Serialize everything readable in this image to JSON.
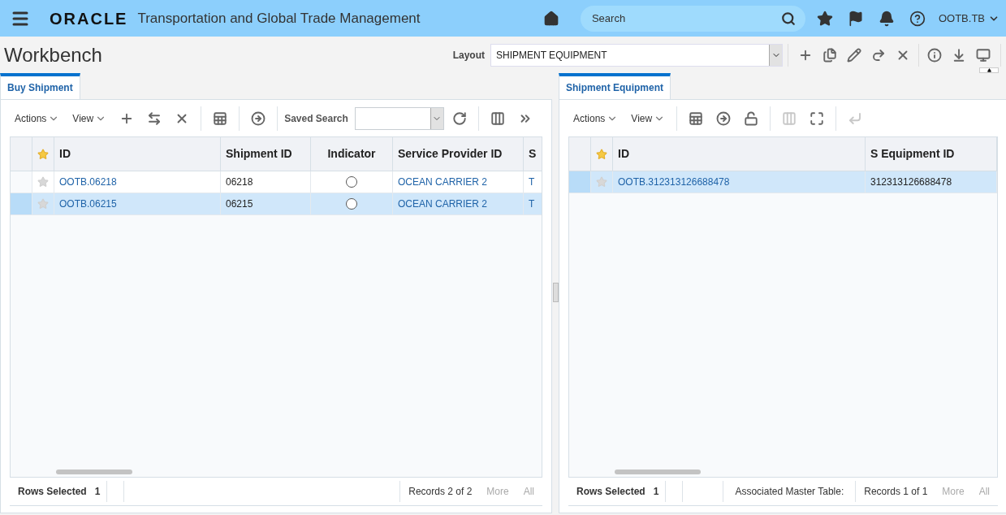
{
  "header": {
    "logo": "ORACLE",
    "app_title": "Transportation and Global Trade Management",
    "search": {
      "placeholder": "Search"
    },
    "user": "OOTB.TB"
  },
  "page_title": "Workbench",
  "layout": {
    "label": "Layout",
    "value": "SHIPMENT EQUIPMENT"
  },
  "layout_tools": [
    {
      "kind": "add",
      "disabled": false
    },
    {
      "kind": "copy",
      "disabled": false
    },
    {
      "kind": "edit",
      "disabled": false
    },
    {
      "kind": "redo",
      "disabled": false
    },
    {
      "kind": "delete",
      "disabled": false
    },
    {
      "kind": "info",
      "disabled": false
    },
    {
      "kind": "download",
      "disabled": false
    },
    {
      "kind": "monitor",
      "disabled": false
    }
  ],
  "panels": [
    {
      "tab": {
        "label": "Buy Shipment",
        "selected": true
      },
      "menus": [
        "Actions",
        "View"
      ],
      "tools": [
        {
          "kind": "add",
          "disabled": false
        },
        {
          "kind": "swap",
          "disabled": false
        },
        {
          "kind": "delete",
          "disabled": false
        },
        {
          "kind": "sep"
        },
        {
          "kind": "table-export",
          "disabled": false
        },
        {
          "kind": "sep"
        },
        {
          "kind": "go",
          "disabled": false
        },
        {
          "kind": "sep"
        },
        {
          "kind": "saved-search",
          "label": "Saved Search"
        },
        {
          "kind": "refresh",
          "disabled": false
        },
        {
          "kind": "sep"
        },
        {
          "kind": "columns",
          "disabled": false
        },
        {
          "kind": "more",
          "disabled": false
        }
      ],
      "columns": [
        "ID",
        "Shipment ID",
        "Indicator",
        "Service Provider ID",
        "S"
      ],
      "rows": [
        {
          "selected": false,
          "cells": [
            {
              "kind": "link",
              "text": "OOTB.06218"
            },
            {
              "kind": "text",
              "text": "06218"
            },
            {
              "kind": "radio"
            },
            {
              "kind": "link",
              "text": "OCEAN CARRIER 2"
            },
            {
              "kind": "link",
              "text": "T"
            }
          ]
        },
        {
          "selected": true,
          "cells": [
            {
              "kind": "link",
              "text": "OOTB.06215"
            },
            {
              "kind": "text",
              "text": "06215"
            },
            {
              "kind": "radio"
            },
            {
              "kind": "link",
              "text": "OCEAN CARRIER 2"
            },
            {
              "kind": "link",
              "text": "T"
            }
          ]
        }
      ],
      "footer": {
        "rows_selected_label": "Rows Selected",
        "rows_selected": "1",
        "records": "Records 2 of 2",
        "more": {
          "label": "More",
          "disabled": true
        },
        "all": {
          "label": "All",
          "disabled": true
        }
      }
    },
    {
      "tab": {
        "label": "Shipment Equipment",
        "selected": true
      },
      "menus": [
        "Actions",
        "View"
      ],
      "tools": [
        {
          "kind": "sep"
        },
        {
          "kind": "table-export",
          "disabled": false
        },
        {
          "kind": "go",
          "disabled": false
        },
        {
          "kind": "unlock",
          "disabled": false
        },
        {
          "kind": "sep"
        },
        {
          "kind": "columns",
          "disabled": true
        },
        {
          "kind": "fit",
          "disabled": false
        },
        {
          "kind": "sep"
        },
        {
          "kind": "enter",
          "disabled": true
        }
      ],
      "columns": [
        "ID",
        "S Equipment ID"
      ],
      "rows": [
        {
          "selected": true,
          "cells": [
            {
              "kind": "link",
              "text": "OOTB.312313126688478"
            },
            {
              "kind": "text",
              "text": "312313126688478"
            }
          ]
        }
      ],
      "footer": {
        "rows_selected_label": "Rows Selected",
        "rows_selected": "1",
        "master": "Associated Master Table:",
        "records": "Records 1 of 1",
        "more": {
          "label": "More",
          "disabled": true
        },
        "all": {
          "label": "All",
          "disabled": true
        }
      }
    }
  ]
}
